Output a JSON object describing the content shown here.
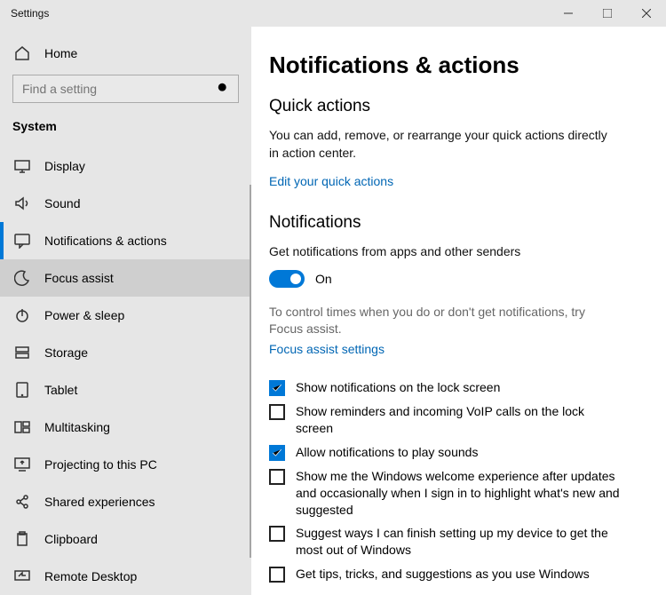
{
  "window": {
    "title": "Settings"
  },
  "sidebar": {
    "home_label": "Home",
    "search_placeholder": "Find a setting",
    "section_label": "System",
    "items": [
      {
        "icon": "display",
        "label": "Display"
      },
      {
        "icon": "sound",
        "label": "Sound"
      },
      {
        "icon": "comment",
        "label": "Notifications & actions"
      },
      {
        "icon": "moon",
        "label": "Focus assist"
      },
      {
        "icon": "power",
        "label": "Power & sleep"
      },
      {
        "icon": "storage",
        "label": "Storage"
      },
      {
        "icon": "tablet",
        "label": "Tablet"
      },
      {
        "icon": "multitask",
        "label": "Multitasking"
      },
      {
        "icon": "project",
        "label": "Projecting to this PC"
      },
      {
        "icon": "share",
        "label": "Shared experiences"
      },
      {
        "icon": "clipboard",
        "label": "Clipboard"
      },
      {
        "icon": "remote",
        "label": "Remote Desktop"
      }
    ]
  },
  "content": {
    "page_title": "Notifications & actions",
    "quick_actions": {
      "heading": "Quick actions",
      "desc": "You can add, remove, or rearrange your quick actions directly in action center.",
      "link": "Edit your quick actions"
    },
    "notifications": {
      "heading": "Notifications",
      "toggle_desc": "Get notifications from apps and other senders",
      "toggle_state": "On",
      "focus_desc": "To control times when you do or don't get notifications, try Focus assist.",
      "focus_link": "Focus assist settings",
      "checks": [
        {
          "checked": true,
          "label": "Show notifications on the lock screen"
        },
        {
          "checked": false,
          "label": "Show reminders and incoming VoIP calls on the lock screen"
        },
        {
          "checked": true,
          "label": "Allow notifications to play sounds"
        },
        {
          "checked": false,
          "label": "Show me the Windows welcome experience after updates and occasionally when I sign in to highlight what's new and suggested"
        },
        {
          "checked": false,
          "label": "Suggest ways I can finish setting up my device to get the most out of Windows"
        },
        {
          "checked": false,
          "label": "Get tips, tricks, and suggestions as you use Windows"
        }
      ]
    }
  }
}
